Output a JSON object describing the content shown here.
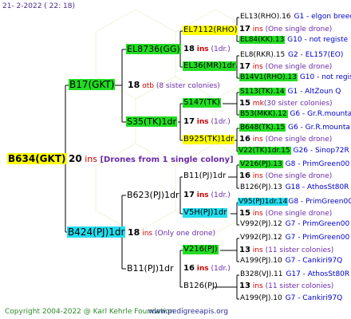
{
  "header": {
    "date": "21-   2-2022  ( 22:  18)"
  },
  "footer": {
    "copyright": "Copyright 2004-2022 @ Karl Kehrle Foundation",
    "site": "www.pedigreeapis.org"
  },
  "colors": {
    "green": "#22dd22",
    "yellow": "#ffff00",
    "cyan": "#22ddee",
    "lines": "#000000",
    "blue": "#0000cc",
    "red": "#cc0000",
    "purple": "#6a2aa8"
  },
  "root": {
    "name": "B634(GKT)",
    "drones_num": "20",
    "drones_ins": "ins",
    "drones_note": "[Drones from 1 single colony]"
  },
  "gen1": [
    {
      "name": "B17(GKT)",
      "num": "18",
      "ins": "otb",
      "note": "(8 sister colonies)"
    },
    {
      "name": "B424(PJ)1dr",
      "num": "18",
      "ins": "ins",
      "note": "(Only one drone)"
    }
  ],
  "gen2": [
    {
      "name": "EL8736(GG)",
      "num": "18",
      "ins": "ins",
      "note": "(1dr.)"
    },
    {
      "name": "S35(TK)1dr",
      "num": "17",
      "ins": "ins",
      "note": "(1dr.)"
    },
    {
      "name": "B623(PJ)1dr",
      "num": "17",
      "ins": "ins",
      "note": "(1dr.)"
    },
    {
      "name": "B11(PJ)1dr",
      "num": "16",
      "ins": "ins",
      "note": "(1dr.)"
    }
  ],
  "gen3": [
    {
      "name": "EL7112(RHO)"
    },
    {
      "name": "EL36(MR)1dr"
    },
    {
      "name": "S147(TK)"
    },
    {
      "name": "B925(TK)1dr"
    },
    {
      "name": "B11(PJ)1dr"
    },
    {
      "name": "V5H(PJ)1dr"
    },
    {
      "name": "V216(PJ)"
    },
    {
      "name": "B126(PJ)"
    }
  ],
  "gen4": [
    {
      "top": "EL13(RHO).16",
      "top_info": "G1 - elgon breed",
      "num": "17",
      "ins": "ins",
      "note": "(One single drone)",
      "bottom": "EL84(KK).13",
      "bottom_info": "G10 - not registe"
    },
    {
      "top": "EL8(RKR).15",
      "top_info": "G2 - EL157(EO)",
      "num": "17",
      "ins": "ins",
      "note": "(One single drone)",
      "bottom": "B14V1(RHO).13",
      "bottom_info": "G10 - not registe"
    },
    {
      "top": "S113(TK).14",
      "top_info": "G1 - AltZoun Q",
      "num": "15",
      "ins": "mk",
      "note": "(30 sister colonies)",
      "bottom": "B53(MKK).12",
      "bottom_info": "G6 - Gr.R.mounta"
    },
    {
      "top": "B648(TK).15",
      "top_info": "G6 - Gr.R.mounta",
      "num": "16",
      "ins": "ins",
      "note": "(One single drone)",
      "bottom": "V22(TK)1dr.15",
      "bottom_info": "G26 - Sinop72R"
    },
    {
      "top": "V216(PJ).13",
      "top_info": "G8 - PrimGreen00",
      "num": "16",
      "ins": "ins",
      "note": "(One single drone)",
      "bottom": "B126(PJ).13",
      "bottom_info": "G18 - AthosSt80R"
    },
    {
      "top": "V95(PJ)1dr.14",
      "top_info": "G8 - PrimGreen00",
      "num": "15",
      "ins": "ins",
      "note": "(One single drone)",
      "bottom": "V992(PJ).12",
      "bottom_info": "G7 - PrimGreen00"
    },
    {
      "top": "V992(PJ).12",
      "top_info": "G7 - PrimGreen00",
      "num": "13",
      "ins": "ins",
      "note": "(11 sister colonies)",
      "bottom": "A199(PJ).10",
      "bottom_info": "G7 - Cankiri97Q"
    },
    {
      "top": "B328(VJ).11",
      "top_info": "G17 - AthosSt80R",
      "num": "13",
      "ins": "ins",
      "note": "(11 sister colonies)",
      "bottom": "A199(PJ).10",
      "bottom_info": "G7 - Cankiri97Q"
    }
  ]
}
